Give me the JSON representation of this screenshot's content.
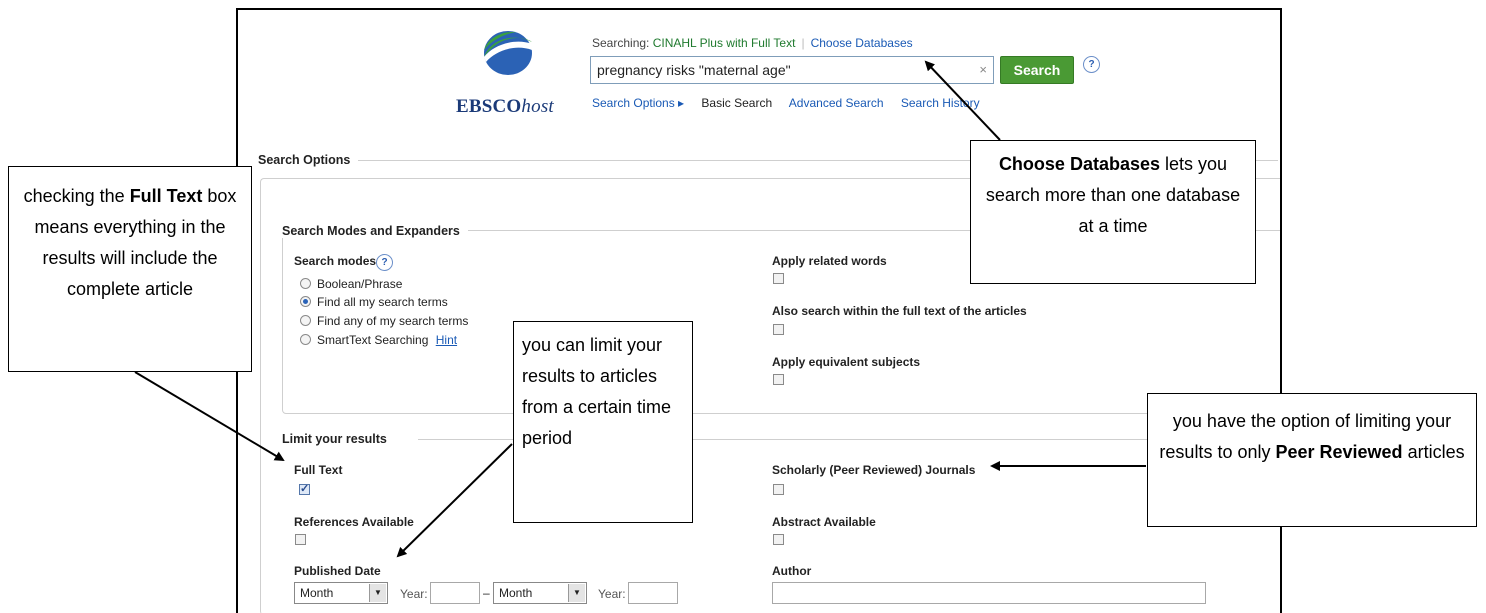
{
  "header": {
    "logo_brand": "EBSCO",
    "logo_suffix": "host",
    "searching_label": "Searching:",
    "database_name": "CINAHL Plus with Full Text",
    "choose_databases_link": "Choose Databases",
    "search_query": "pregnancy risks \"maternal age\"",
    "clear_symbol": "×",
    "search_button": "Search",
    "help_symbol": "?",
    "subnav": {
      "search_options": "Search Options ▸",
      "basic_search": "Basic Search",
      "advanced_search": "Advanced Search",
      "search_history": "Search History"
    }
  },
  "search_options": {
    "title": "Search Options",
    "modes_section": {
      "title": "Search Modes and Expanders",
      "search_modes_label": "Search modes",
      "modes": [
        {
          "label": "Boolean/Phrase",
          "selected": false
        },
        {
          "label": "Find all my search terms",
          "selected": true
        },
        {
          "label": "Find any of my search terms",
          "selected": false
        },
        {
          "label": "SmartText Searching",
          "selected": false
        }
      ],
      "hint_link": "Hint",
      "expanders": [
        {
          "label": "Apply related words",
          "checked": false
        },
        {
          "label": "Also search within the full text of the articles",
          "checked": false
        },
        {
          "label": "Apply equivalent subjects",
          "checked": false
        }
      ]
    },
    "limits_section": {
      "title": "Limit your results",
      "full_text": {
        "label": "Full Text",
        "checked": true
      },
      "references_available": {
        "label": "References Available",
        "checked": false
      },
      "published_date": {
        "label": "Published Date",
        "from_month": "Month",
        "year_label": "Year:",
        "dash": "–",
        "to_month": "Month"
      },
      "scholarly": {
        "label": "Scholarly (Peer Reviewed) Journals",
        "checked": false
      },
      "abstract_available": {
        "label": "Abstract Available",
        "checked": false
      },
      "author_label": "Author"
    }
  },
  "callouts": {
    "choose_db": {
      "bold": "Choose Databases",
      "rest": " lets you search more than one database at a time"
    },
    "full_text": {
      "pre": "checking the ",
      "bold": "Full Text",
      "rest": " box means everything in the results will include the complete article"
    },
    "date": {
      "text": "you can limit your results to articles from a certain time period"
    },
    "peer": {
      "pre": "you have the option of limiting your results to only ",
      "bold": "Peer Reviewed",
      "rest": " articles"
    }
  },
  "colors": {
    "search_button": "#4a9a34",
    "link": "#1a5ab5",
    "database_name": "#1f7a2e",
    "logo_text": "#1b3a78"
  }
}
